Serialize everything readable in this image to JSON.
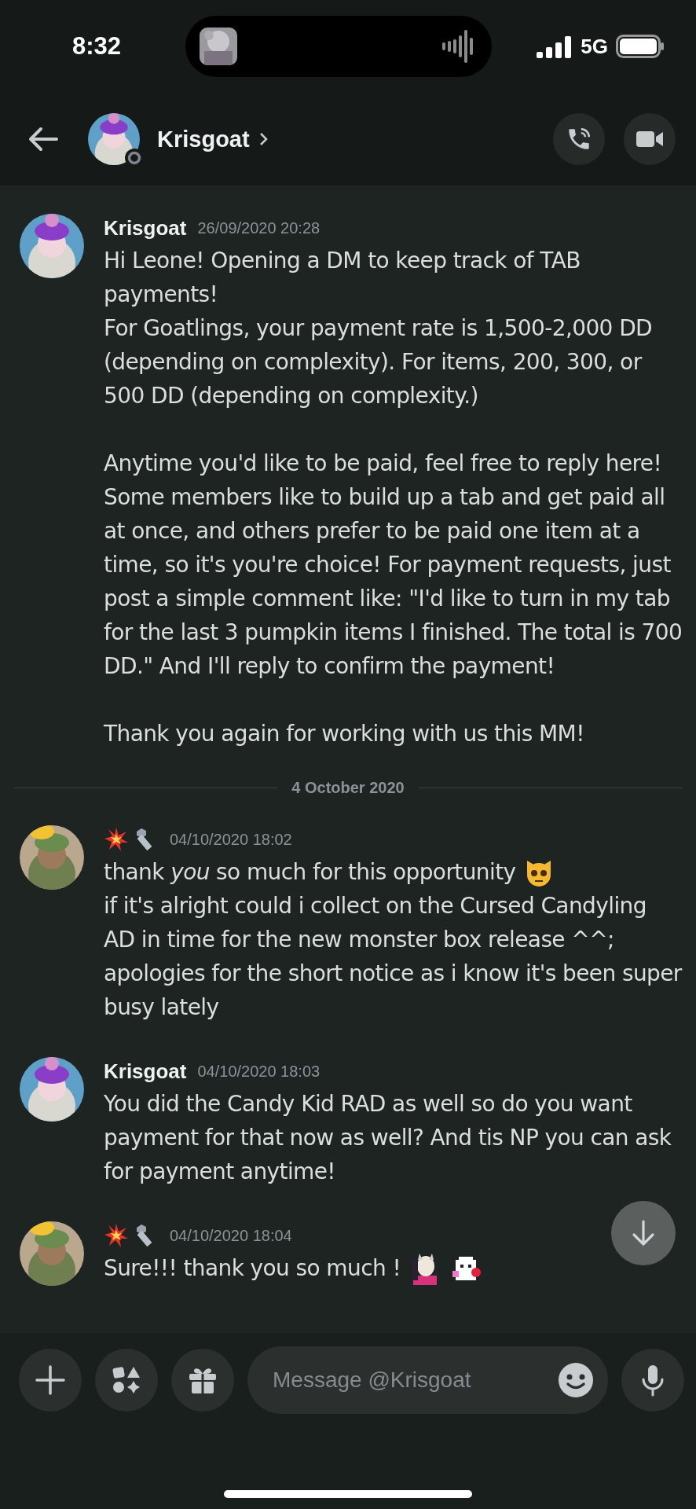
{
  "status_bar": {
    "time": "8:32",
    "network": "5G"
  },
  "header": {
    "name": "Krisgoat",
    "online": false
  },
  "messages": [
    {
      "kind": "named",
      "author": "Krisgoat",
      "timestamp": "26/09/2020 20:28",
      "text": "Hi Leone! Opening a DM to keep track of TAB payments!\nFor Goatlings, your payment rate is 1,500-2,000 DD (depending on complexity). For items, 200, 300, or 500 DD (depending on complexity.)\n\nAnytime you'd like to be paid, feel free to reply here! Some members like to build up a tab and get paid all at once, and others prefer to be paid one item at a time, so it's you're choice! For payment requests, just post a simple comment like: \"I'd like to turn in my tab for the last 3 pumpkin items I finished. The total is 700 DD.\" And I'll reply to confirm the payment!\n\nThank you again for working with us this MM!"
    },
    {
      "kind": "divider",
      "label": "4 October 2020"
    },
    {
      "kind": "badged",
      "timestamp": "04/10/2020 18:02",
      "text": "thank *you* so much for this opportunity",
      "inline_emojis": [
        {
          "kind": "cat"
        }
      ],
      "text2": "if it's alright could i collect on the Cursed Candyling AD in time for the new monster box release ^^; apologies for the short notice as i know it's been super busy lately"
    },
    {
      "kind": "named",
      "author": "Krisgoat",
      "timestamp": "04/10/2020 18:03",
      "text": "You did the Candy Kid RAD as well so do you want payment for that now as well? And tis NP you can ask for payment anytime!"
    },
    {
      "kind": "badged",
      "timestamp": "04/10/2020 18:04",
      "text": "Sure!!! thank you so much !",
      "inline_emojis": [
        {
          "kind": "girl"
        },
        {
          "kind": "cow"
        }
      ]
    }
  ],
  "composer": {
    "placeholder": "Message @Krisgoat"
  }
}
